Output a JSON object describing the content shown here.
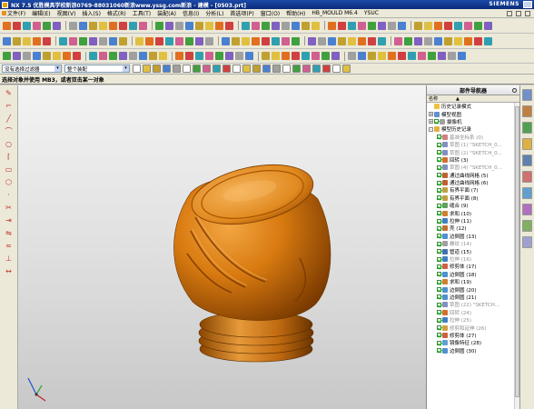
{
  "app": {
    "title": "NX 7.5 优胜模具学校新浪0769-88031060新浪www.yssg.com新浪 - 建模 - [0503.prt]",
    "brand": "SIEMENS"
  },
  "menu": {
    "items": [
      "文件(F)",
      "编辑(E)",
      "视图(V)",
      "插入(S)",
      "格式(R)",
      "工具(T)",
      "装配(A)",
      "信息(I)",
      "分析(L)",
      "首选项(P)",
      "窗口(O)",
      "帮助(H)",
      "HB_MOULD M6.4",
      "YSUC"
    ]
  },
  "toolbar": {
    "selection_filter": "没有选择过滤器",
    "assembly_scope": "整个装配"
  },
  "status": {
    "prompt": "选择对象并使用 MB3，或者双击某一对象"
  },
  "navigator": {
    "title": "部件导航器",
    "column_name": "名称",
    "rows": [
      {
        "label": "历史记录模式",
        "indent": 0,
        "exp": "",
        "check": false,
        "icon": "#f0c040",
        "gray": false,
        "num": ""
      },
      {
        "label": "模型视图",
        "indent": 0,
        "exp": "+",
        "check": false,
        "icon": "#6090d0",
        "gray": false,
        "num": ""
      },
      {
        "label": "摄像机",
        "indent": 0,
        "exp": "+",
        "check": true,
        "icon": "#a0a0a0",
        "gray": false,
        "num": ""
      },
      {
        "label": "模型历史记录",
        "indent": 0,
        "exp": "-",
        "check": false,
        "icon": "#e0b040",
        "gray": false,
        "num": ""
      },
      {
        "label": "基准坐标系 (0)",
        "indent": 1,
        "exp": "",
        "check": true,
        "icon": "#d08080",
        "gray": true,
        "num": ""
      },
      {
        "label": "草图 (1) \"SKETCH_0...",
        "indent": 1,
        "exp": "",
        "check": true,
        "icon": "#8090c0",
        "gray": true,
        "num": ""
      },
      {
        "label": "草图 (2) \"SKETCH_0...",
        "indent": 1,
        "exp": "",
        "check": true,
        "icon": "#8090c0",
        "gray": true,
        "num": ""
      },
      {
        "label": "回转 (3)",
        "indent": 1,
        "exp": "",
        "check": true,
        "icon": "#d07030",
        "gray": false,
        "num": ""
      },
      {
        "label": "草图 (4) \"SKETCH_0...",
        "indent": 1,
        "exp": "",
        "check": true,
        "icon": "#8090c0",
        "gray": true,
        "num": ""
      },
      {
        "label": "通过曲线网格 (5)",
        "indent": 1,
        "exp": "",
        "check": true,
        "icon": "#c06030",
        "gray": false,
        "num": ""
      },
      {
        "label": "通过曲线网格 (6)",
        "indent": 1,
        "exp": "",
        "check": true,
        "icon": "#c06030",
        "gray": false,
        "num": ""
      },
      {
        "label": "有界平面 (7)",
        "indent": 1,
        "exp": "",
        "check": true,
        "icon": "#c0a040",
        "gray": false,
        "num": ""
      },
      {
        "label": "有界平面 (8)",
        "indent": 1,
        "exp": "",
        "check": true,
        "icon": "#c0a040",
        "gray": false,
        "num": ""
      },
      {
        "label": "缝合 (9)",
        "indent": 1,
        "exp": "",
        "check": true,
        "icon": "#60a060",
        "gray": false,
        "num": ""
      },
      {
        "label": "求和 (10)",
        "indent": 1,
        "exp": "",
        "check": true,
        "icon": "#d08030",
        "gray": false,
        "num": ""
      },
      {
        "label": "拉伸 (11)",
        "indent": 1,
        "exp": "",
        "check": true,
        "icon": "#4080c0",
        "gray": false,
        "num": ""
      },
      {
        "label": "壳 (12)",
        "indent": 1,
        "exp": "",
        "check": true,
        "icon": "#c07030",
        "gray": false,
        "num": ""
      },
      {
        "label": "边倒圆 (13)",
        "indent": 1,
        "exp": "",
        "check": true,
        "icon": "#5090d0",
        "gray": false,
        "num": ""
      },
      {
        "label": "螺纹 (14)",
        "indent": 1,
        "exp": "",
        "check": true,
        "icon": "#a0a0a0",
        "gray": true,
        "num": ""
      },
      {
        "label": "管道 (15)",
        "indent": 1,
        "exp": "",
        "check": true,
        "icon": "#4070b0",
        "gray": false,
        "num": ""
      },
      {
        "label": "拉伸 (16)",
        "indent": 1,
        "exp": "",
        "check": true,
        "icon": "#4080c0",
        "gray": true,
        "num": ""
      },
      {
        "label": "修剪体 (17)",
        "indent": 1,
        "exp": "",
        "check": true,
        "icon": "#d06040",
        "gray": false,
        "num": ""
      },
      {
        "label": "边倒圆 (18)",
        "indent": 1,
        "exp": "",
        "check": true,
        "icon": "#5090d0",
        "gray": false,
        "num": ""
      },
      {
        "label": "求和 (19)",
        "indent": 1,
        "exp": "",
        "check": true,
        "icon": "#d08030",
        "gray": false,
        "num": ""
      },
      {
        "label": "边倒圆 (20)",
        "indent": 1,
        "exp": "",
        "check": true,
        "icon": "#5090d0",
        "gray": false,
        "num": ""
      },
      {
        "label": "边倒圆 (21)",
        "indent": 1,
        "exp": "",
        "check": true,
        "icon": "#5090d0",
        "gray": false,
        "num": ""
      },
      {
        "label": "草图 (22) \"SKETCH...",
        "indent": 1,
        "exp": "",
        "check": true,
        "icon": "#8090c0",
        "gray": true,
        "num": ""
      },
      {
        "label": "回转 (24)",
        "indent": 1,
        "exp": "",
        "check": true,
        "icon": "#d07030",
        "gray": true,
        "num": ""
      },
      {
        "label": "拉伸 (25)",
        "indent": 1,
        "exp": "",
        "check": true,
        "icon": "#4080c0",
        "gray": true,
        "num": ""
      },
      {
        "label": "修剪和延伸 (26)",
        "indent": 1,
        "exp": "",
        "check": true,
        "icon": "#d0a040",
        "gray": true,
        "num": ""
      },
      {
        "label": "修剪体 (27)",
        "indent": 1,
        "exp": "",
        "check": true,
        "icon": "#d06040",
        "gray": false,
        "num": ""
      },
      {
        "label": "镜像特征 (28)",
        "indent": 1,
        "exp": "",
        "check": true,
        "icon": "#60a0d0",
        "gray": false,
        "num": ""
      },
      {
        "label": "边倒圆 (30)",
        "indent": 1,
        "exp": "",
        "check": true,
        "icon": "#5090d0",
        "gray": false,
        "num": ""
      }
    ]
  },
  "colors": {
    "part_orange": "#d87a10",
    "part_highlight": "#f0a040",
    "part_shadow": "#8a4600"
  },
  "icons": {
    "toolbar_row1": [
      "new-icon",
      "open-icon",
      "save-icon",
      "undo-icon",
      "redo-icon",
      "cut-icon",
      "copy-icon",
      "paste-icon",
      "sketch-icon",
      "extrude-icon",
      "revolve-icon",
      "hole-icon",
      "blend-icon",
      "chamfer-icon",
      "shell-icon",
      "fit-icon",
      "zoom-icon",
      "rotate-icon",
      "pan-icon",
      "shaded-icon"
    ],
    "left": [
      "sketch-icon",
      "profile-icon",
      "line-icon",
      "arc-icon",
      "circle-icon",
      "fillet-icon",
      "rectangle-icon",
      "polygon-icon",
      "point-icon",
      "trim-icon",
      "extend-icon",
      "mirror-icon",
      "offset-icon",
      "constraint-icon",
      "dimension-icon"
    ],
    "resource": [
      "assembly-navigator-icon",
      "constraint-navigator-icon",
      "part-navigator-icon",
      "reuse-library-icon",
      "history-icon",
      "role-icon",
      "web-browser-icon",
      "system-material-icon",
      "process-studio-icon",
      "system-scene-icon"
    ]
  }
}
